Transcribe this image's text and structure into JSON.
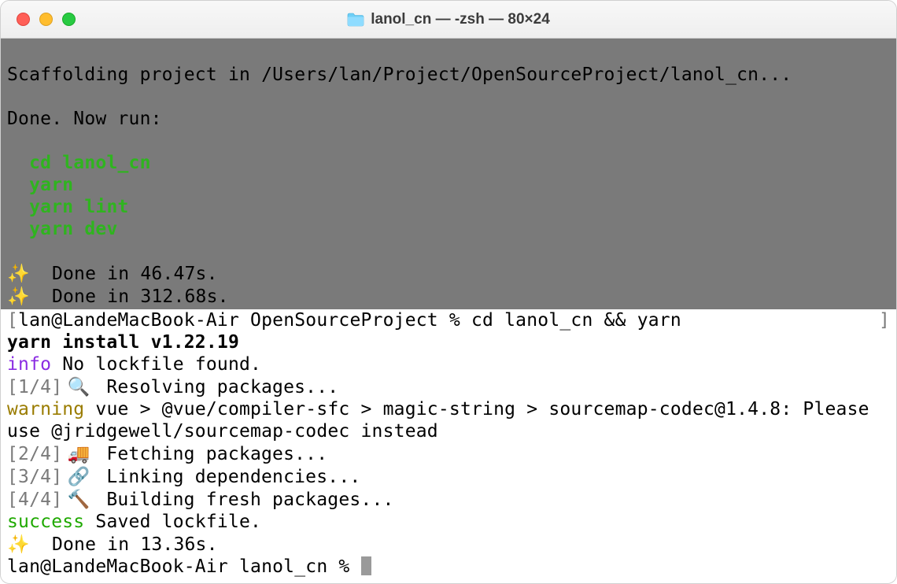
{
  "window": {
    "title": "lanol_cn — -zsh — 80×24"
  },
  "scrollback": {
    "empty1": " ",
    "line1": "Scaffolding project in /Users/lan/Project/OpenSourceProject/lanol_cn...",
    "empty2": " ",
    "line2": "Done. Now run:",
    "empty3": " ",
    "cmd1": "  cd lanol_cn",
    "cmd2": "  yarn",
    "cmd3": "  yarn lint",
    "cmd4": "  yarn dev",
    "empty4": " ",
    "done1_icon": "✨",
    "done1_text": "  Done in 46.47s.",
    "done2_icon": "✨",
    "done2_text": "  Done in 312.68s."
  },
  "active": {
    "prompt1_open": "[",
    "prompt1_text": "lan@LandeMacBook-Air OpenSourceProject % cd lanol_cn && yarn",
    "prompt1_close": "]",
    "yarn_install": "yarn install v1.22.19",
    "info_label": "info",
    "info_text": " No lockfile found.",
    "step1_num": "[1/4]",
    "step1_icon": " 🔍 ",
    "step1_text": " Resolving packages...",
    "warn_label": "warning",
    "warn_text": " vue > @vue/compiler-sfc > magic-string > sourcemap-codec@1.4.8: Please use @jridgewell/sourcemap-codec instead",
    "step2_num": "[2/4]",
    "step2_icon": " 🚚 ",
    "step2_text": " Fetching packages...",
    "step3_num": "[3/4]",
    "step3_icon": " 🔗 ",
    "step3_text": " Linking dependencies...",
    "step4_num": "[4/4]",
    "step4_icon": " 🔨 ",
    "step4_text": " Building fresh packages...",
    "success_label": "success",
    "success_text": " Saved lockfile.",
    "done_icon": "✨",
    "done_text": "  Done in 13.36s.",
    "prompt2": "lan@LandeMacBook-Air lanol_cn % "
  }
}
